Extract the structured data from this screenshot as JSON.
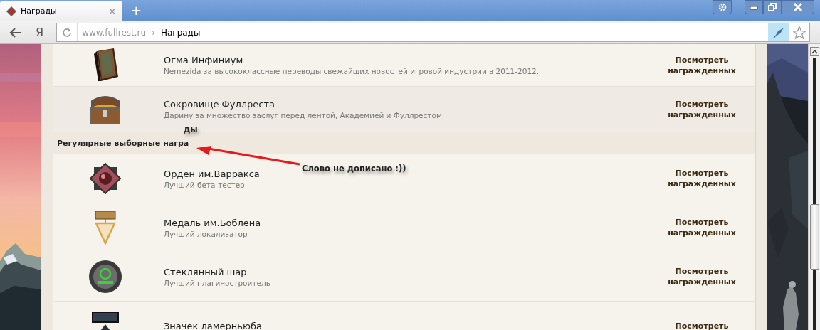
{
  "browser": {
    "tab": {
      "title": "Награды",
      "close": "×"
    },
    "new_tab": "+",
    "yandex": "Я",
    "address": {
      "host": "www.fullrest.ru",
      "separator": "›",
      "page": "Награды"
    }
  },
  "awards": [
    {
      "kind": "award",
      "title": "Огма Инфиниум",
      "description": "Nemezida за высококлассные переводы свежайших новостей игровой индустрии в 2011-2012.",
      "button": "Посмотреть награжденных",
      "highlighted": false
    },
    {
      "kind": "award",
      "title": "Сокровище Фуллреста",
      "description": "Дарину за множество заслуг перед лентой, Академией и Фуллрестом",
      "button": "Посмотреть награжденных",
      "highlighted": true
    },
    {
      "kind": "section",
      "title": "Регулярные выборные награ"
    },
    {
      "kind": "award",
      "title": "Орден им.Варракса",
      "description": "Лучший бета-тестер",
      "button": "Посмотреть награжденных",
      "highlighted": false
    },
    {
      "kind": "award",
      "title": "Медаль им.Боблена",
      "description": "Лучший локализатор",
      "button": "Посмотреть награжденных",
      "highlighted": false
    },
    {
      "kind": "award",
      "title": "Стеклянный шар",
      "description": "Лучший плагиностроитель",
      "button": "Посмотреть награжденных",
      "highlighted": false
    },
    {
      "kind": "award",
      "title": "Значек ламерньюба",
      "button": "Посмотреть",
      "highlighted": false
    }
  ],
  "annotations": [
    {
      "text": "ды"
    },
    {
      "text": "Слово не дописано :))"
    }
  ]
}
